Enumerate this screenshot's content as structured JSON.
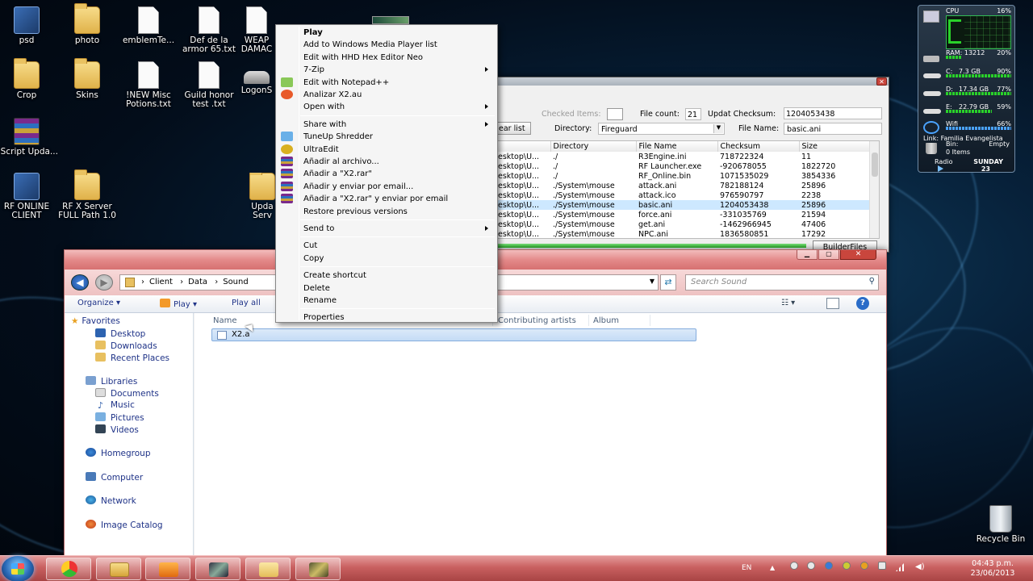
{
  "desktop_icons": [
    {
      "label": "psd",
      "kind": "shortcut"
    },
    {
      "label": "photo",
      "kind": "folder"
    },
    {
      "label": "emblemTe...",
      "kind": "doc"
    },
    {
      "label": "Def de la armor 65.txt",
      "kind": "doc"
    },
    {
      "label": "WEAP DAMAC",
      "kind": "doc"
    },
    {
      "label": "Crop",
      "kind": "folder"
    },
    {
      "label": "Skins",
      "kind": "folder"
    },
    {
      "label": "!NEW Misc Potions.txt",
      "kind": "doc"
    },
    {
      "label": "Guild honor test .txt",
      "kind": "doc"
    },
    {
      "label": "LogonS",
      "kind": "app"
    },
    {
      "label": "nScript Upda...",
      "kind": "rar"
    },
    {
      "label": "RF ONLINE CLIENT",
      "kind": "shortcut"
    },
    {
      "label": "RF X Server FULL Path 1.0",
      "kind": "folder"
    },
    {
      "label": "Upda Serv",
      "kind": "folder"
    },
    {
      "label": "Recycle Bin",
      "kind": "bin"
    }
  ],
  "gadget": {
    "cpu_label": "CPU",
    "cpu_pct": "16%",
    "ram_label": "RAM: 13212",
    "ram_pct": "20%",
    "drives": [
      {
        "label": "C:",
        "size": "7.3 GB",
        "pct": "90%"
      },
      {
        "label": "D:",
        "size": "17.34 GB",
        "pct": "77%"
      },
      {
        "label": "E:",
        "size": "22.79 GB",
        "pct": "59%"
      }
    ],
    "wifi_label": "Wifi",
    "wifi_pct": "66%",
    "link": "Link: Familia Evangelista",
    "bin_label": "Bin:",
    "bin_status": "Empty",
    "bin_items": "0 Items",
    "radio": "Radio",
    "day": "SUNDAY",
    "date": "23"
  },
  "tool_window": {
    "checked_items_label": "Checked Items:",
    "file_count_label": "File count:",
    "file_count": "21",
    "updat_checksum_label": "Updat Checksum:",
    "updat_checksum": "1204053438",
    "clear_list": "ear list",
    "directory_label": "Directory:",
    "directory_value": "Fireguard",
    "file_name_label": "File Name:",
    "file_name_value": "basic.ani",
    "columns": [
      "Directory",
      "File Name",
      "Checksum",
      "Size"
    ],
    "rows": [
      {
        "path": "esktop\\U...",
        "dir": "./",
        "file": "R3Engine.ini",
        "checksum": "718722324",
        "size": "11"
      },
      {
        "path": "esktop\\U...",
        "dir": "./",
        "file": "RF Launcher.exe",
        "checksum": "-920678055",
        "size": "1822720"
      },
      {
        "path": "esktop\\U...",
        "dir": "./",
        "file": "RF_Online.bin",
        "checksum": "1071535029",
        "size": "3854336"
      },
      {
        "path": "esktop\\U...",
        "dir": "./System\\mouse",
        "file": "attack.ani",
        "checksum": "782188124",
        "size": "25896"
      },
      {
        "path": "esktop\\U...",
        "dir": "./System\\mouse",
        "file": "attack.ico",
        "checksum": "976590797",
        "size": "2238"
      },
      {
        "path": "esktop\\U...",
        "dir": "./System\\mouse",
        "file": "basic.ani",
        "checksum": "1204053438",
        "size": "25896"
      },
      {
        "path": "esktop\\U...",
        "dir": "./System\\mouse",
        "file": "force.ani",
        "checksum": "-331035769",
        "size": "21594"
      },
      {
        "path": "esktop\\U...",
        "dir": "./System\\mouse",
        "file": "get.ani",
        "checksum": "-1462966945",
        "size": "47406"
      },
      {
        "path": "esktop\\U...",
        "dir": "./System\\mouse",
        "file": "NPC.ani",
        "checksum": "1836580851",
        "size": "17292"
      }
    ],
    "builder_button": "BuilderFiles"
  },
  "explorer": {
    "breadcrumb": [
      "Client",
      "Data",
      "Sound"
    ],
    "search_placeholder": "Search Sound",
    "toolbar": {
      "organize": "Organize",
      "play": "Play",
      "play_all": "Play all"
    },
    "nav": {
      "favorites": "Favorites",
      "desktop": "Desktop",
      "downloads": "Downloads",
      "recent": "Recent Places",
      "libraries": "Libraries",
      "documents": "Documents",
      "music": "Music",
      "pictures": "Pictures",
      "videos": "Videos",
      "homegroup": "Homegroup",
      "computer": "Computer",
      "network": "Network",
      "image_catalog": "Image Catalog"
    },
    "columns": {
      "name": "Name",
      "artists": "Contributing artists",
      "album": "Album"
    },
    "file": "X2.a"
  },
  "context_menu": {
    "items": [
      {
        "label": "Play",
        "bold": true
      },
      {
        "label": "Add to Windows Media Player list"
      },
      {
        "label": "Edit with HHD Hex Editor Neo"
      },
      {
        "label": "7-Zip",
        "submenu": true
      },
      {
        "label": "Edit with Notepad++",
        "icon": "notepad"
      },
      {
        "label": "Analizar X2.au",
        "icon": "antivirus"
      },
      {
        "label": "Open with",
        "submenu": true
      },
      {
        "label": "Share with",
        "submenu": true,
        "sep_before": true
      },
      {
        "label": "TuneUp Shredder",
        "icon": "shredder"
      },
      {
        "label": "UltraEdit",
        "icon": "ultraedit"
      },
      {
        "label": "Añadir al archivo...",
        "icon": "rar"
      },
      {
        "label": "Añadir a \"X2.rar\"",
        "icon": "rar"
      },
      {
        "label": "Añadir y enviar por email...",
        "icon": "rar"
      },
      {
        "label": "Añadir a \"X2.rar\" y enviar por email",
        "icon": "rar"
      },
      {
        "label": "Restore previous versions"
      },
      {
        "label": "Send to",
        "submenu": true,
        "sep_before": true
      },
      {
        "label": "Cut",
        "sep_before": true
      },
      {
        "label": "Copy"
      },
      {
        "label": "Create shortcut",
        "sep_before": true
      },
      {
        "label": "Delete"
      },
      {
        "label": "Rename"
      },
      {
        "label": "Properties",
        "sep_before": true
      }
    ]
  },
  "taskbar": {
    "lang": "EN",
    "time": "04:43 p.m.",
    "date": "23/06/2013",
    "apps": [
      "chrome-icon",
      "explorer-icon",
      "media-player-icon",
      "game-icon",
      "folder-icon",
      "rf-icon"
    ]
  }
}
